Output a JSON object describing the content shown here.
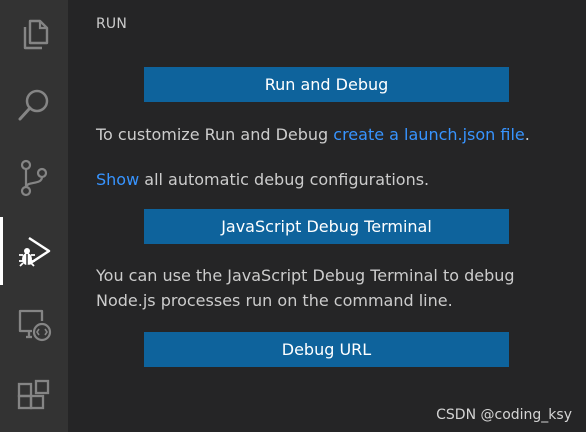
{
  "activity_bar": {
    "items": [
      {
        "icon": "files-icon",
        "active": false
      },
      {
        "icon": "search-icon",
        "active": false
      },
      {
        "icon": "source-control-icon",
        "active": false
      },
      {
        "icon": "run-debug-icon",
        "active": true
      },
      {
        "icon": "remote-explorer-icon",
        "active": false
      },
      {
        "icon": "extensions-icon",
        "active": false
      }
    ],
    "colors": {
      "background": "#333333",
      "icon": "#858585",
      "active_icon": "#ffffff"
    }
  },
  "sidebar": {
    "title": "RUN",
    "run_debug_button": "Run and Debug",
    "customize": {
      "text": "To customize Run and Debug ",
      "link": "create a launch.json file",
      "suffix": "."
    },
    "show": {
      "link": "Show",
      "text": " all automatic debug configurations."
    },
    "js_terminal_button": "JavaScript Debug Terminal",
    "terminal_desc": {
      "line1": "You can use the JavaScript Debug Terminal to debug",
      "line2": "Node.js processes run on the command line."
    },
    "debug_url_button": "Debug URL"
  },
  "watermark": "CSDN @coding_ksy",
  "colors": {
    "sidebar_background": "#252526",
    "button": "#0e639c",
    "link": "#3794ff",
    "text": "#cccccc"
  }
}
